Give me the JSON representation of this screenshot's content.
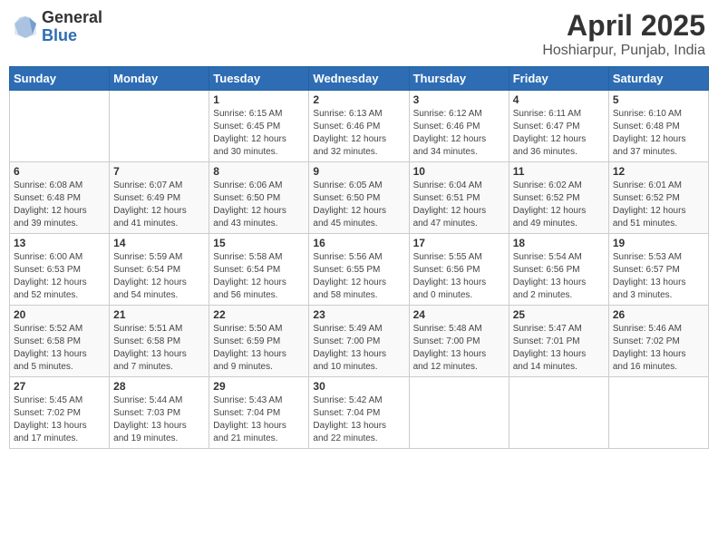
{
  "header": {
    "logo_general": "General",
    "logo_blue": "Blue",
    "title": "April 2025",
    "location": "Hoshiarpur, Punjab, India"
  },
  "weekdays": [
    "Sunday",
    "Monday",
    "Tuesday",
    "Wednesday",
    "Thursday",
    "Friday",
    "Saturday"
  ],
  "weeks": [
    [
      {
        "day": "",
        "info": ""
      },
      {
        "day": "",
        "info": ""
      },
      {
        "day": "1",
        "info": "Sunrise: 6:15 AM\nSunset: 6:45 PM\nDaylight: 12 hours\nand 30 minutes."
      },
      {
        "day": "2",
        "info": "Sunrise: 6:13 AM\nSunset: 6:46 PM\nDaylight: 12 hours\nand 32 minutes."
      },
      {
        "day": "3",
        "info": "Sunrise: 6:12 AM\nSunset: 6:46 PM\nDaylight: 12 hours\nand 34 minutes."
      },
      {
        "day": "4",
        "info": "Sunrise: 6:11 AM\nSunset: 6:47 PM\nDaylight: 12 hours\nand 36 minutes."
      },
      {
        "day": "5",
        "info": "Sunrise: 6:10 AM\nSunset: 6:48 PM\nDaylight: 12 hours\nand 37 minutes."
      }
    ],
    [
      {
        "day": "6",
        "info": "Sunrise: 6:08 AM\nSunset: 6:48 PM\nDaylight: 12 hours\nand 39 minutes."
      },
      {
        "day": "7",
        "info": "Sunrise: 6:07 AM\nSunset: 6:49 PM\nDaylight: 12 hours\nand 41 minutes."
      },
      {
        "day": "8",
        "info": "Sunrise: 6:06 AM\nSunset: 6:50 PM\nDaylight: 12 hours\nand 43 minutes."
      },
      {
        "day": "9",
        "info": "Sunrise: 6:05 AM\nSunset: 6:50 PM\nDaylight: 12 hours\nand 45 minutes."
      },
      {
        "day": "10",
        "info": "Sunrise: 6:04 AM\nSunset: 6:51 PM\nDaylight: 12 hours\nand 47 minutes."
      },
      {
        "day": "11",
        "info": "Sunrise: 6:02 AM\nSunset: 6:52 PM\nDaylight: 12 hours\nand 49 minutes."
      },
      {
        "day": "12",
        "info": "Sunrise: 6:01 AM\nSunset: 6:52 PM\nDaylight: 12 hours\nand 51 minutes."
      }
    ],
    [
      {
        "day": "13",
        "info": "Sunrise: 6:00 AM\nSunset: 6:53 PM\nDaylight: 12 hours\nand 52 minutes."
      },
      {
        "day": "14",
        "info": "Sunrise: 5:59 AM\nSunset: 6:54 PM\nDaylight: 12 hours\nand 54 minutes."
      },
      {
        "day": "15",
        "info": "Sunrise: 5:58 AM\nSunset: 6:54 PM\nDaylight: 12 hours\nand 56 minutes."
      },
      {
        "day": "16",
        "info": "Sunrise: 5:56 AM\nSunset: 6:55 PM\nDaylight: 12 hours\nand 58 minutes."
      },
      {
        "day": "17",
        "info": "Sunrise: 5:55 AM\nSunset: 6:56 PM\nDaylight: 13 hours\nand 0 minutes."
      },
      {
        "day": "18",
        "info": "Sunrise: 5:54 AM\nSunset: 6:56 PM\nDaylight: 13 hours\nand 2 minutes."
      },
      {
        "day": "19",
        "info": "Sunrise: 5:53 AM\nSunset: 6:57 PM\nDaylight: 13 hours\nand 3 minutes."
      }
    ],
    [
      {
        "day": "20",
        "info": "Sunrise: 5:52 AM\nSunset: 6:58 PM\nDaylight: 13 hours\nand 5 minutes."
      },
      {
        "day": "21",
        "info": "Sunrise: 5:51 AM\nSunset: 6:58 PM\nDaylight: 13 hours\nand 7 minutes."
      },
      {
        "day": "22",
        "info": "Sunrise: 5:50 AM\nSunset: 6:59 PM\nDaylight: 13 hours\nand 9 minutes."
      },
      {
        "day": "23",
        "info": "Sunrise: 5:49 AM\nSunset: 7:00 PM\nDaylight: 13 hours\nand 10 minutes."
      },
      {
        "day": "24",
        "info": "Sunrise: 5:48 AM\nSunset: 7:00 PM\nDaylight: 13 hours\nand 12 minutes."
      },
      {
        "day": "25",
        "info": "Sunrise: 5:47 AM\nSunset: 7:01 PM\nDaylight: 13 hours\nand 14 minutes."
      },
      {
        "day": "26",
        "info": "Sunrise: 5:46 AM\nSunset: 7:02 PM\nDaylight: 13 hours\nand 16 minutes."
      }
    ],
    [
      {
        "day": "27",
        "info": "Sunrise: 5:45 AM\nSunset: 7:02 PM\nDaylight: 13 hours\nand 17 minutes."
      },
      {
        "day": "28",
        "info": "Sunrise: 5:44 AM\nSunset: 7:03 PM\nDaylight: 13 hours\nand 19 minutes."
      },
      {
        "day": "29",
        "info": "Sunrise: 5:43 AM\nSunset: 7:04 PM\nDaylight: 13 hours\nand 21 minutes."
      },
      {
        "day": "30",
        "info": "Sunrise: 5:42 AM\nSunset: 7:04 PM\nDaylight: 13 hours\nand 22 minutes."
      },
      {
        "day": "",
        "info": ""
      },
      {
        "day": "",
        "info": ""
      },
      {
        "day": "",
        "info": ""
      }
    ]
  ]
}
